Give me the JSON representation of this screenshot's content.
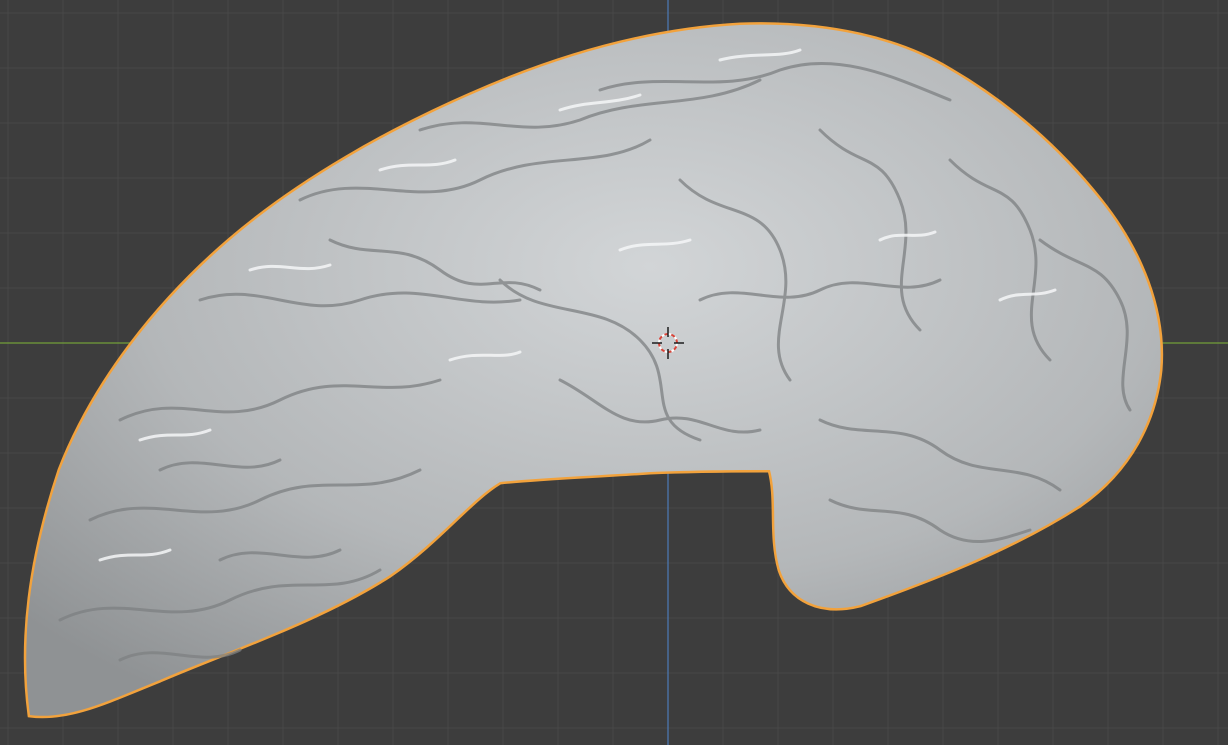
{
  "viewport": {
    "background_color": "#3d3d3d",
    "grid_color": "#484848",
    "x_axis_color": "#6a8f3a",
    "y_axis_color": "#4a6fa0",
    "selection_outline_color": "#f2a23c",
    "mesh_color": "#b9bcbe",
    "cursor_icon": "3d-cursor-icon",
    "selected_object": "brain-mesh"
  }
}
